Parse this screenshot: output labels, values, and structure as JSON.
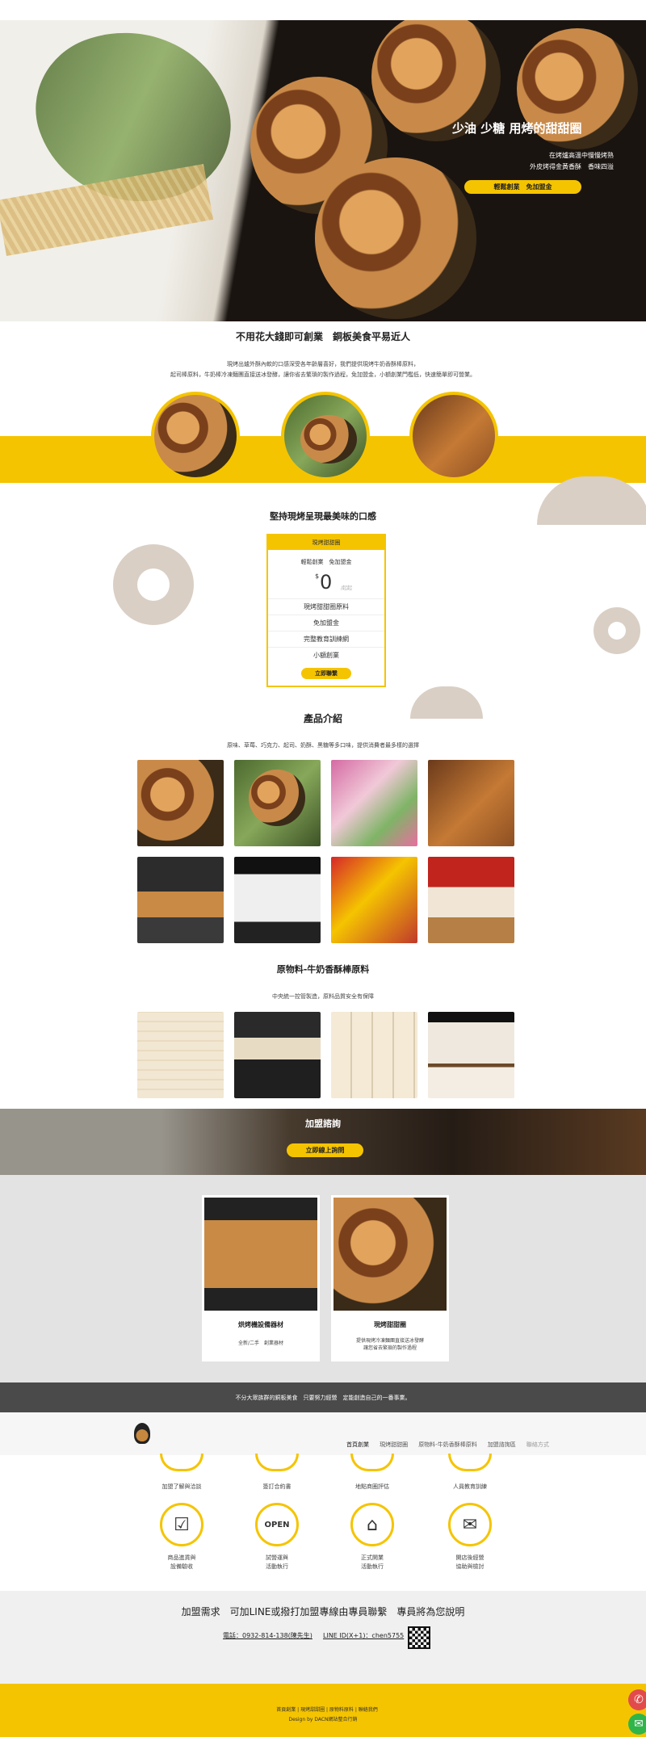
{
  "hero": {
    "title": "少油 少糖 用烤的甜甜圈",
    "line1": "在烤爐高溫中慢慢烤熟",
    "line2": "外皮烤得金黃香酥　香味四溢",
    "cta": "輕鬆創業　免加盟金"
  },
  "intro": {
    "title": "不用花大錢即可創業　銅板美食平易近人",
    "text1": "現烤出爐外酥內軟的口感深受各年齡層喜好，我們提供現烤牛奶香酥棒原料，",
    "text2": "起司棒原料，牛奶棒冷凍麵團直接送冰發酵，讓你省去繁瑣的製作過程，免加盟金，小額創業門檻低，快速簡單即可營業。"
  },
  "pricing": {
    "title": "堅持現烤呈現最美味的口感",
    "card_header": "現烤甜甜圈",
    "subtitle": "輕鬆創業　免加盟金",
    "currency": "$",
    "amount": "0",
    "unit": "/起起",
    "items": [
      "現烤甜甜圈原料",
      "免加盟金",
      "完整教育訓練網",
      "小額創業"
    ],
    "button": "立即聯繫"
  },
  "products": {
    "title": "產品介紹",
    "text": "原味、草莓、巧克力、起司、奶酥、黑糖等多口味，提供消費者最多樣的選擇"
  },
  "materials": {
    "title": "原物料-牛奶香酥棒原料",
    "text": "中央統一控管製造，原料品質安全有保障"
  },
  "join": {
    "title": "加盟諮詢",
    "button": "立即線上詢問"
  },
  "equipment": [
    {
      "title": "烘烤機設備器材",
      "desc": "全新/二手　創業器材"
    },
    {
      "title": "現烤甜甜圈",
      "desc1": "提供現烤冷凍麵團直接送冰發酵",
      "desc2": "讓您省去繁瑣的製作過程"
    }
  ],
  "banner": {
    "text": "不分大眾族群的銅板美食　只要努力經營　定能創造自己的一番事業。"
  },
  "nav": {
    "items": [
      "首頁創業",
      "現烤甜甜圈",
      "原物料-牛奶香酥棒原料",
      "加盟諮詢區",
      "聯絡方式"
    ]
  },
  "steps": {
    "row1": [
      "加盟了解與洽談",
      "簽訂合約書",
      "地點商圈評估",
      "人員教育訓練"
    ],
    "row2": [
      {
        "l1": "商品進貨與",
        "l2": "設備驗收"
      },
      {
        "l1": "試營運與",
        "l2": "活動執行"
      },
      {
        "l1": "正式開業",
        "l2": "活動執行"
      },
      {
        "l1": "開店後經營",
        "l2": "協助與檢討"
      }
    ],
    "row2_icons": [
      "checklist-icon",
      "open-sign-icon",
      "storefront-icon",
      "chat-icon"
    ]
  },
  "contact": {
    "title": "加盟需求　可加LINE或撥打加盟專線由專員聯繫　專員將為您說明",
    "phone": "電話：0932-814-138(陳先生)",
    "line": "LINE ID(X+1)：chen5755"
  },
  "footer": {
    "links": [
      "首頁創業",
      "現烤甜甜圈",
      "原物料原料",
      "聯絡我們"
    ],
    "credit": "Design by DACN網站整合行銷"
  },
  "colors": {
    "accent": "#f5c400",
    "dark": "#4a4a4a"
  }
}
